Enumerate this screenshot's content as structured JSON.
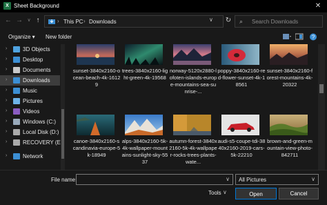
{
  "window": {
    "title": "Sheet Background",
    "app_icon": "excel-icon",
    "close_glyph": "✕"
  },
  "nav": {
    "back_glyph": "←",
    "forward_glyph": "→",
    "recent_glyph": "∨",
    "up_glyph": "↑",
    "breadcrumbs": [
      "This PC",
      "Downloads"
    ],
    "separator": "›",
    "dropdown_glyph": "∨",
    "refresh_glyph": "↻",
    "search_placeholder": "Search Downloads",
    "search_glyph": "⌕"
  },
  "toolbar": {
    "organize_label": "Organize ▾",
    "new_folder_label": "New folder"
  },
  "sidebar": {
    "chevron": "›",
    "items": [
      {
        "label": "3D Objects",
        "icon": "3d-objects-icon",
        "color": "#4fa3e0",
        "selected": false
      },
      {
        "label": "Desktop",
        "icon": "desktop-icon",
        "color": "#3c8fd4",
        "selected": false
      },
      {
        "label": "Documents",
        "icon": "documents-icon",
        "color": "#c9c9c9",
        "selected": false
      },
      {
        "label": "Downloads",
        "icon": "downloads-icon",
        "color": "#3c8fd4",
        "selected": true
      },
      {
        "label": "Music",
        "icon": "music-icon",
        "color": "#3c8fd4",
        "selected": false
      },
      {
        "label": "Pictures",
        "icon": "pictures-icon",
        "color": "#6db3e8",
        "selected": false
      },
      {
        "label": "Videos",
        "icon": "videos-icon",
        "color": "#8a5cc2",
        "selected": false
      },
      {
        "label": "Windows (C:)",
        "icon": "drive-windows-icon",
        "color": "#9ab",
        "selected": false
      },
      {
        "label": "Local Disk (D:)",
        "icon": "drive-icon",
        "color": "#aaa",
        "selected": false
      },
      {
        "label": "RECOVERY (E:)",
        "icon": "drive-icon",
        "color": "#aaa",
        "selected": false
      },
      {
        "label": "Network",
        "icon": "network-icon",
        "color": "#3c8fd4",
        "selected": false
      }
    ]
  },
  "files": [
    {
      "name": "sunset-3840x2160-ocean-beach-4k-16129",
      "thumb": "sunset-beach-thumbnail"
    },
    {
      "name": "trees-3840x2160-light-green-4k-19568",
      "thumb": "aurora-trees-thumbnail"
    },
    {
      "name": "norway-5120x2880-lofoten-islands-europe-mountains-sea-sunrise-...",
      "thumb": "lofoten-sunrise-thumbnail"
    },
    {
      "name": "poppy-3840x2160-red-flower-sunset-4k-18561",
      "thumb": "poppy-flower-thumbnail"
    },
    {
      "name": "sunset-3840x2160-forest-mountains-4k-20322",
      "thumb": "sunset-forest-thumbnail"
    },
    {
      "name": "canoe-3840x2160-scandinavia-europe-5k-18949",
      "thumb": "canoe-lake-thumbnail"
    },
    {
      "name": "alps-3840x2160-5k-4k-wallpaper-mountains-sunlight-sky-5537",
      "thumb": "alps-mountains-thumbnail"
    },
    {
      "name": "autumn-forest-3840x2160-5k-4k-wallpaper-rocks-trees-plants-wate...",
      "thumb": "autumn-forest-thumbnail"
    },
    {
      "name": "audi-s5-coupe-tdi-3840x2160-2019-cars-5k-22210",
      "thumb": "audi-car-thumbnail"
    },
    {
      "name": "brown-and-green-mountain-view-photo-842711",
      "thumb": "green-hills-thumbnail"
    }
  ],
  "bottom": {
    "file_name_label": "File name:",
    "file_name_value": "",
    "filter_label": "All Pictures",
    "tools_label": "Tools",
    "open_label": "Open",
    "cancel_label": "Cancel",
    "dropdown_glyph": "∨"
  }
}
